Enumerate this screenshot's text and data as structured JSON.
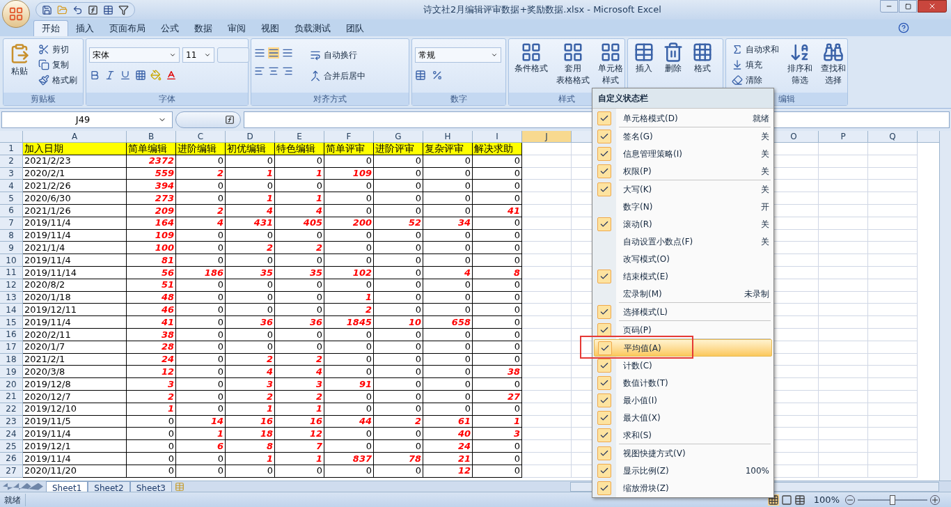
{
  "window": {
    "title": "诗文社2月编辑评审数据+奖励数据.xlsx - Microsoft Excel"
  },
  "tabs": [
    {
      "label": "开始",
      "selected": true
    },
    {
      "label": "插入",
      "selected": false
    },
    {
      "label": "页面布局",
      "selected": false
    },
    {
      "label": "公式",
      "selected": false
    },
    {
      "label": "数据",
      "selected": false
    },
    {
      "label": "审阅",
      "selected": false
    },
    {
      "label": "视图",
      "selected": false
    },
    {
      "label": "负载测试",
      "selected": false
    },
    {
      "label": "团队",
      "selected": false
    }
  ],
  "ribbon": {
    "groups": [
      {
        "kind": "clipboard",
        "label": "剪贴板",
        "large": "粘贴",
        "small": [
          "剪切",
          "复制",
          "格式刷"
        ]
      },
      {
        "kind": "font",
        "label": "字体",
        "font_name": "宋体",
        "font_size": "11"
      },
      {
        "kind": "alignment",
        "label": "对齐方式",
        "small": [
          "自动换行",
          "合并后居中"
        ]
      },
      {
        "kind": "number",
        "label": "数字",
        "format": "常规"
      },
      {
        "kind": "styles",
        "label": "样式",
        "large": [
          {
            "lines": [
              "条件格式"
            ]
          },
          {
            "lines": [
              "套用",
              "表格格式"
            ]
          },
          {
            "lines": [
              "单元格",
              "样式"
            ]
          }
        ]
      },
      {
        "kind": "cells",
        "large": [
          {
            "lines": [
              "插入"
            ]
          },
          {
            "lines": [
              "删除"
            ]
          },
          {
            "lines": [
              "格式"
            ]
          }
        ]
      },
      {
        "kind": "editing",
        "label": "编辑",
        "small": [
          "自动求和",
          "填充",
          "清除"
        ],
        "large": [
          {
            "lines": [
              "排序和",
              "筛选"
            ]
          },
          {
            "lines": [
              "查找和",
              "选择"
            ]
          }
        ]
      }
    ]
  },
  "formula_bar": {
    "name_box": "J49"
  },
  "sheet": {
    "columns": [
      "A",
      "B",
      "C",
      "D",
      "E",
      "F",
      "G",
      "H",
      "I",
      "J"
    ],
    "right_columns": [
      "O",
      "P",
      "Q"
    ],
    "header_row": {
      "number": "1",
      "cells": [
        "加入日期",
        "简单编辑",
        "进阶编辑",
        "初优编辑",
        "特色编辑",
        "简单评审",
        "进阶评审",
        "复杂评审",
        "解决求助"
      ]
    },
    "rows": [
      {
        "number": "2",
        "date": "2021/2/23",
        "values": [
          "2372",
          "0",
          "0",
          "0",
          "0",
          "0",
          "0",
          "0"
        ],
        "flagged": [
          true,
          false,
          false,
          false,
          false,
          false,
          false,
          false
        ]
      },
      {
        "number": "3",
        "date": "2020/2/1",
        "values": [
          "559",
          "2",
          "1",
          "1",
          "109",
          "0",
          "0",
          "0"
        ],
        "flagged": [
          true,
          true,
          true,
          true,
          true,
          false,
          false,
          false
        ]
      },
      {
        "number": "4",
        "date": "2021/2/26",
        "values": [
          "394",
          "0",
          "0",
          "0",
          "0",
          "0",
          "0",
          "0"
        ],
        "flagged": [
          true,
          false,
          false,
          false,
          false,
          false,
          false,
          false
        ]
      },
      {
        "number": "5",
        "date": "2020/6/30",
        "values": [
          "273",
          "0",
          "1",
          "1",
          "0",
          "0",
          "0",
          "0"
        ],
        "flagged": [
          true,
          false,
          true,
          true,
          false,
          false,
          false,
          false
        ]
      },
      {
        "number": "6",
        "date": "2021/1/26",
        "values": [
          "209",
          "2",
          "4",
          "4",
          "0",
          "0",
          "0",
          "41"
        ],
        "flagged": [
          true,
          true,
          true,
          true,
          false,
          false,
          false,
          true
        ]
      },
      {
        "number": "7",
        "date": "2019/11/4",
        "values": [
          "164",
          "4",
          "431",
          "405",
          "200",
          "52",
          "34",
          "0"
        ],
        "flagged": [
          true,
          true,
          true,
          true,
          true,
          true,
          true,
          false
        ]
      },
      {
        "number": "8",
        "date": "2019/11/4",
        "values": [
          "109",
          "0",
          "0",
          "0",
          "0",
          "0",
          "0",
          "0"
        ],
        "flagged": [
          true,
          false,
          false,
          false,
          false,
          false,
          false,
          false
        ]
      },
      {
        "number": "9",
        "date": "2021/1/4",
        "values": [
          "100",
          "0",
          "2",
          "2",
          "0",
          "0",
          "0",
          "0"
        ],
        "flagged": [
          true,
          false,
          true,
          true,
          false,
          false,
          false,
          false
        ]
      },
      {
        "number": "10",
        "date": "2019/11/4",
        "values": [
          "81",
          "0",
          "0",
          "0",
          "0",
          "0",
          "0",
          "0"
        ],
        "flagged": [
          true,
          false,
          false,
          false,
          false,
          false,
          false,
          false
        ]
      },
      {
        "number": "11",
        "date": "2019/11/14",
        "values": [
          "56",
          "186",
          "35",
          "35",
          "102",
          "0",
          "4",
          "8"
        ],
        "flagged": [
          true,
          true,
          true,
          true,
          true,
          false,
          true,
          true
        ]
      },
      {
        "number": "12",
        "date": "2020/8/2",
        "values": [
          "51",
          "0",
          "0",
          "0",
          "0",
          "0",
          "0",
          "0"
        ],
        "flagged": [
          true,
          false,
          false,
          false,
          false,
          false,
          false,
          false
        ]
      },
      {
        "number": "13",
        "date": "2020/1/18",
        "values": [
          "48",
          "0",
          "0",
          "0",
          "1",
          "0",
          "0",
          "0"
        ],
        "flagged": [
          true,
          false,
          false,
          false,
          true,
          false,
          false,
          false
        ]
      },
      {
        "number": "14",
        "date": "2019/12/11",
        "values": [
          "46",
          "0",
          "0",
          "0",
          "2",
          "0",
          "0",
          "0"
        ],
        "flagged": [
          true,
          false,
          false,
          false,
          true,
          false,
          false,
          false
        ]
      },
      {
        "number": "15",
        "date": "2019/11/4",
        "values": [
          "41",
          "0",
          "36",
          "36",
          "1845",
          "10",
          "658",
          "0"
        ],
        "flagged": [
          true,
          false,
          true,
          true,
          true,
          true,
          true,
          false
        ]
      },
      {
        "number": "16",
        "date": "2020/2/11",
        "values": [
          "38",
          "0",
          "0",
          "0",
          "0",
          "0",
          "0",
          "0"
        ],
        "flagged": [
          true,
          false,
          false,
          false,
          false,
          false,
          false,
          false
        ]
      },
      {
        "number": "17",
        "date": "2020/1/7",
        "values": [
          "28",
          "0",
          "0",
          "0",
          "0",
          "0",
          "0",
          "0"
        ],
        "flagged": [
          true,
          false,
          false,
          false,
          false,
          false,
          false,
          false
        ]
      },
      {
        "number": "18",
        "date": "2021/2/1",
        "values": [
          "24",
          "0",
          "2",
          "2",
          "0",
          "0",
          "0",
          "0"
        ],
        "flagged": [
          true,
          false,
          true,
          true,
          false,
          false,
          false,
          false
        ]
      },
      {
        "number": "19",
        "date": "2020/3/8",
        "values": [
          "12",
          "0",
          "4",
          "4",
          "0",
          "0",
          "0",
          "38"
        ],
        "flagged": [
          true,
          false,
          true,
          true,
          false,
          false,
          false,
          true
        ]
      },
      {
        "number": "20",
        "date": "2019/12/8",
        "values": [
          "3",
          "0",
          "3",
          "3",
          "91",
          "0",
          "0",
          "0"
        ],
        "flagged": [
          true,
          false,
          true,
          true,
          true,
          false,
          false,
          false
        ]
      },
      {
        "number": "21",
        "date": "2020/12/7",
        "values": [
          "2",
          "0",
          "2",
          "2",
          "0",
          "0",
          "0",
          "27"
        ],
        "flagged": [
          true,
          false,
          true,
          true,
          false,
          false,
          false,
          true
        ]
      },
      {
        "number": "22",
        "date": "2019/12/10",
        "values": [
          "1",
          "0",
          "1",
          "1",
          "0",
          "0",
          "0",
          "0"
        ],
        "flagged": [
          true,
          false,
          true,
          true,
          false,
          false,
          false,
          false
        ]
      },
      {
        "number": "23",
        "date": "2019/11/5",
        "values": [
          "0",
          "14",
          "16",
          "16",
          "44",
          "2",
          "61",
          "1"
        ],
        "flagged": [
          false,
          true,
          true,
          true,
          true,
          true,
          true,
          true
        ]
      },
      {
        "number": "24",
        "date": "2019/11/4",
        "values": [
          "0",
          "1",
          "18",
          "12",
          "0",
          "0",
          "40",
          "3"
        ],
        "flagged": [
          false,
          true,
          true,
          true,
          false,
          false,
          true,
          true
        ]
      },
      {
        "number": "25",
        "date": "2019/12/1",
        "values": [
          "0",
          "6",
          "8",
          "7",
          "0",
          "0",
          "24",
          "0"
        ],
        "flagged": [
          false,
          true,
          true,
          true,
          false,
          false,
          true,
          false
        ]
      },
      {
        "number": "26",
        "date": "2019/11/4",
        "values": [
          "0",
          "0",
          "1",
          "1",
          "837",
          "78",
          "21",
          "0"
        ],
        "flagged": [
          false,
          false,
          true,
          true,
          true,
          true,
          true,
          false
        ]
      },
      {
        "number": "27",
        "date": "2020/11/20",
        "values": [
          "0",
          "0",
          "0",
          "0",
          "0",
          "0",
          "12",
          "0"
        ],
        "flagged": [
          false,
          false,
          false,
          false,
          false,
          false,
          true,
          false
        ]
      }
    ]
  },
  "sheet_tabs": [
    {
      "label": "Sheet1",
      "selected": true
    },
    {
      "label": "Sheet2",
      "selected": false
    },
    {
      "label": "Sheet3",
      "selected": false
    }
  ],
  "status_bar": {
    "mode": "就绪",
    "zoom": "100%",
    "zoom_slider": {
      "level": 0.5
    }
  },
  "context_menu": {
    "title": "自定义状态栏",
    "items": [
      {
        "label": "单元格模式(D)",
        "value": "就绪",
        "checked": true,
        "selected": false,
        "separator_after": true
      },
      {
        "label": "签名(G)",
        "value": "关",
        "checked": true,
        "selected": false,
        "separator_after": false
      },
      {
        "label": "信息管理策略(I)",
        "value": "关",
        "checked": true,
        "selected": false,
        "separator_after": false
      },
      {
        "label": "权限(P)",
        "value": "关",
        "checked": true,
        "selected": false,
        "separator_after": true
      },
      {
        "label": "大写(K)",
        "value": "关",
        "checked": true,
        "selected": false,
        "separator_after": false
      },
      {
        "label": "数字(N)",
        "value": "开",
        "checked": false,
        "selected": false,
        "separator_after": false
      },
      {
        "label": "滚动(R)",
        "value": "关",
        "checked": true,
        "selected": false,
        "separator_after": false
      },
      {
        "label": "自动设置小数点(F)",
        "value": "关",
        "checked": false,
        "selected": false,
        "separator_after": false
      },
      {
        "label": "改写模式(O)",
        "checked": false,
        "selected": false,
        "separator_after": false
      },
      {
        "label": "结束模式(E)",
        "checked": true,
        "selected": false,
        "separator_after": false
      },
      {
        "label": "宏录制(M)",
        "value": "未录制",
        "checked": false,
        "selected": false,
        "separator_after": true
      },
      {
        "label": "选择模式(L)",
        "checked": true,
        "selected": false,
        "separator_after": true
      },
      {
        "label": "页码(P)",
        "checked": true,
        "selected": false,
        "separator_after": true
      },
      {
        "label": "平均值(A)",
        "checked": true,
        "selected": true,
        "separator_after": false
      },
      {
        "label": "计数(C)",
        "checked": true,
        "selected": false,
        "separator_after": false
      },
      {
        "label": "数值计数(T)",
        "checked": true,
        "selected": false,
        "separator_after": false
      },
      {
        "label": "最小值(I)",
        "checked": true,
        "selected": false,
        "separator_after": false
      },
      {
        "label": "最大值(X)",
        "checked": true,
        "selected": false,
        "separator_after": false
      },
      {
        "label": "求和(S)",
        "checked": true,
        "selected": false,
        "separator_after": true
      },
      {
        "label": "视图快捷方式(V)",
        "checked": true,
        "selected": false,
        "separator_after": false
      },
      {
        "label": "显示比例(Z)",
        "value": "100%",
        "checked": true,
        "selected": false,
        "separator_after": false
      },
      {
        "label": "缩放滑块(Z)",
        "checked": true,
        "selected": false,
        "separator_after": false
      }
    ]
  }
}
